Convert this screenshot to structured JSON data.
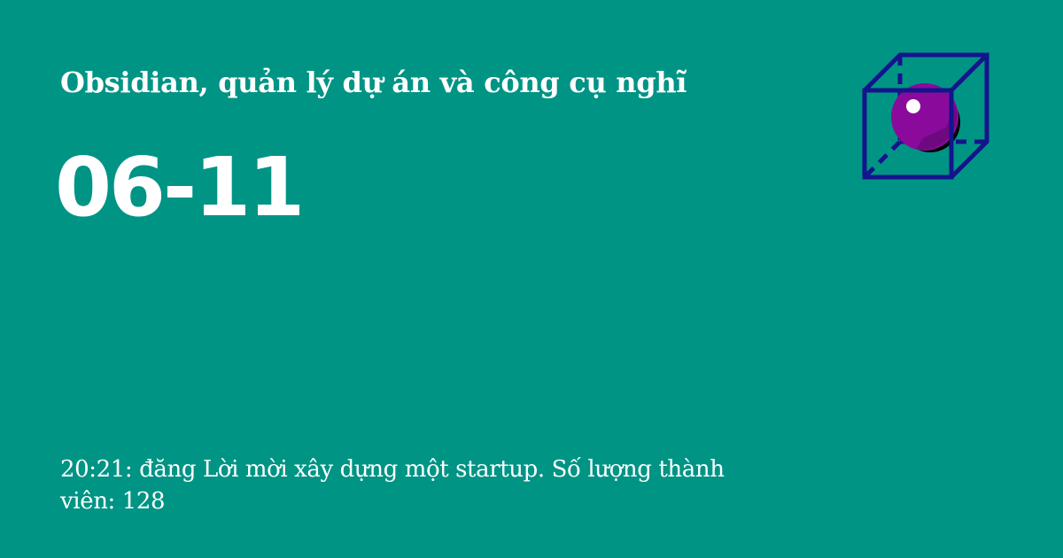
{
  "card": {
    "site_title": "Obsidian, quản lý dự án và công cụ nghĩ",
    "date": "06-11",
    "post_info": "20:21: đăng Lời mời xây dựng một startup. Số lượng thành viên: 128"
  },
  "colors": {
    "background": "#009485",
    "text": "#ffffff",
    "cube_stroke": "#14148c",
    "sphere": "#8a0a9c",
    "sphere_shadow": "#000000"
  },
  "icons": {
    "logo": "cube-sphere-logo-icon"
  }
}
